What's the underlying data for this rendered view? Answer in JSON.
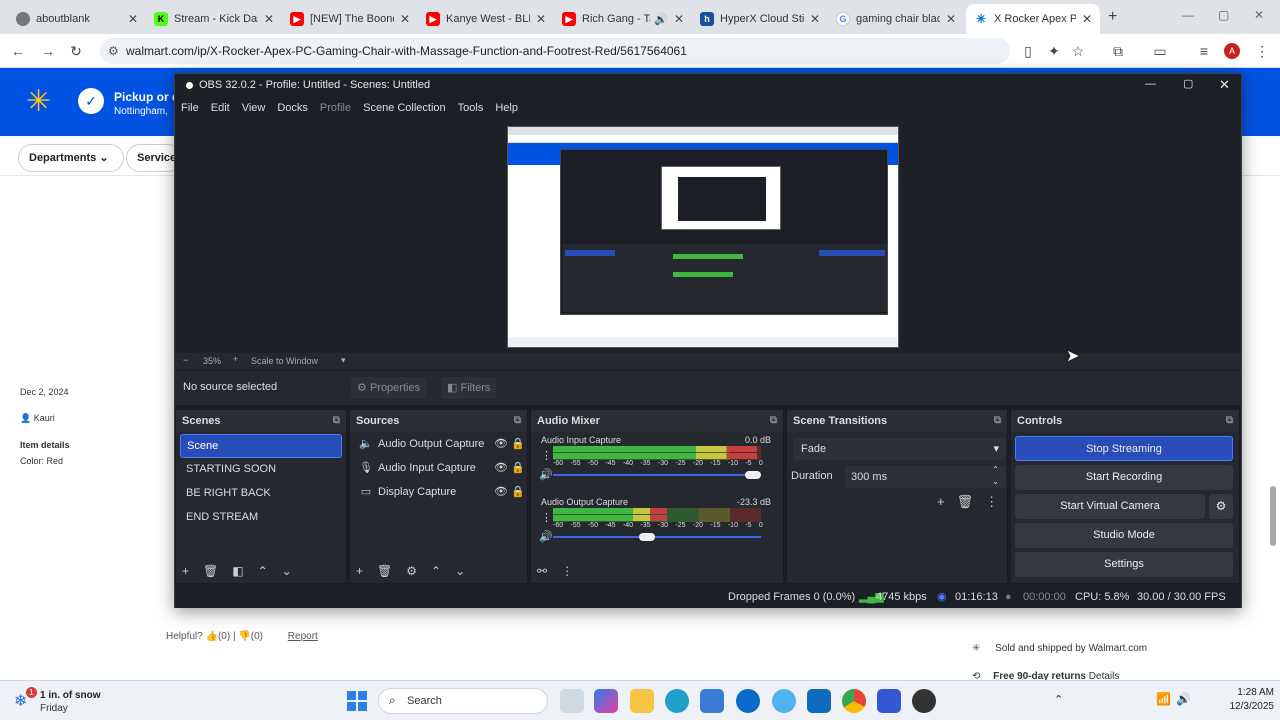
{
  "browser": {
    "tabs": [
      {
        "title": "aboutblank",
        "color": "#5f6368"
      },
      {
        "title": "Stream - Kick Dash",
        "color": "#53fc18"
      },
      {
        "title": "[NEW] The Boondo",
        "color": "#ff0000"
      },
      {
        "title": "Kanye West - BLKK",
        "color": "#ff0000"
      },
      {
        "title": "Rich Gang - Ta",
        "color": "#ff0000"
      },
      {
        "title": "HyperX Cloud Stin",
        "color": "#1a4fa0"
      },
      {
        "title": "gaming chair black",
        "color": "#4285f4"
      },
      {
        "title": "X Rocker Apex PC",
        "color": "#0071dc"
      }
    ],
    "url": "walmart.com/ip/X-Rocker-Apex-PC-Gaming-Chair-with-Massage-Function-and-Footrest-Red/5617564061",
    "profile_initial": "A"
  },
  "walmart": {
    "pickup": "Pickup or d",
    "location": "Nottingham,",
    "departments": "Departments",
    "services": "Services",
    "review_date": "Dec 2, 2024",
    "reviewer": "Kauri",
    "item_details": "Item details",
    "color_label": "Color: Red",
    "helpful": "Helpful?",
    "helpful_up": "(0)",
    "helpful_down": "(0)",
    "report": "Report",
    "sold_by": "Sold and shipped by Walmart.com",
    "returns": "Free 90-day returns",
    "returns_details": "Details"
  },
  "obs": {
    "title": "OBS 32.0.2 - Profile: Untitled - Scenes: Untitled",
    "menu": [
      "File",
      "Edit",
      "View",
      "Docks",
      "Profile",
      "Scene Collection",
      "Tools",
      "Help"
    ],
    "zoom": "35%",
    "scale_mode": "Scale to Window",
    "no_source": "No source selected",
    "properties": "Properties",
    "filters": "Filters",
    "scenes_title": "Scenes",
    "scenes": [
      "Scene",
      "STARTING SOON",
      "BE RIGHT BACK",
      "END STREAM"
    ],
    "sources_title": "Sources",
    "sources": [
      {
        "name": "Audio Output Capture",
        "icon": "speaker-icon"
      },
      {
        "name": "Audio Input Capture",
        "icon": "microphone-icon"
      },
      {
        "name": "Display Capture",
        "icon": "monitor-icon"
      }
    ],
    "mixer_title": "Audio Mixer",
    "mixer": [
      {
        "name": "Audio Input Capture",
        "db": "0.0 dB",
        "level": 0.98,
        "volume": 1.0
      },
      {
        "name": "Audio Output Capture",
        "db": "-23.3 dB",
        "level": 0.55,
        "volume": 0.45
      }
    ],
    "meter_ticks": [
      "-60",
      "-55",
      "-50",
      "-45",
      "-40",
      "-35",
      "-30",
      "-25",
      "-20",
      "-15",
      "-10",
      "-5",
      "0"
    ],
    "transitions_title": "Scene Transitions",
    "transition": "Fade",
    "duration_label": "Duration",
    "duration": "300 ms",
    "controls_title": "Controls",
    "controls": [
      "Stop Streaming",
      "Start Recording",
      "Start Virtual Camera",
      "Studio Mode",
      "Settings"
    ],
    "status": {
      "dropped": "Dropped Frames 0 (0.0%)",
      "bitrate": "4745 kbps",
      "stream_time": "01:16:13",
      "rec_time": "00:00:00",
      "cpu": "CPU: 5.8%",
      "fps": "30.00 / 30.00 FPS"
    }
  },
  "taskbar": {
    "weather": "1 in. of snow",
    "weather_day": "Friday",
    "weather_badge": "1",
    "search": "Search",
    "time": "1:28 AM",
    "date": "12/3/2025"
  }
}
